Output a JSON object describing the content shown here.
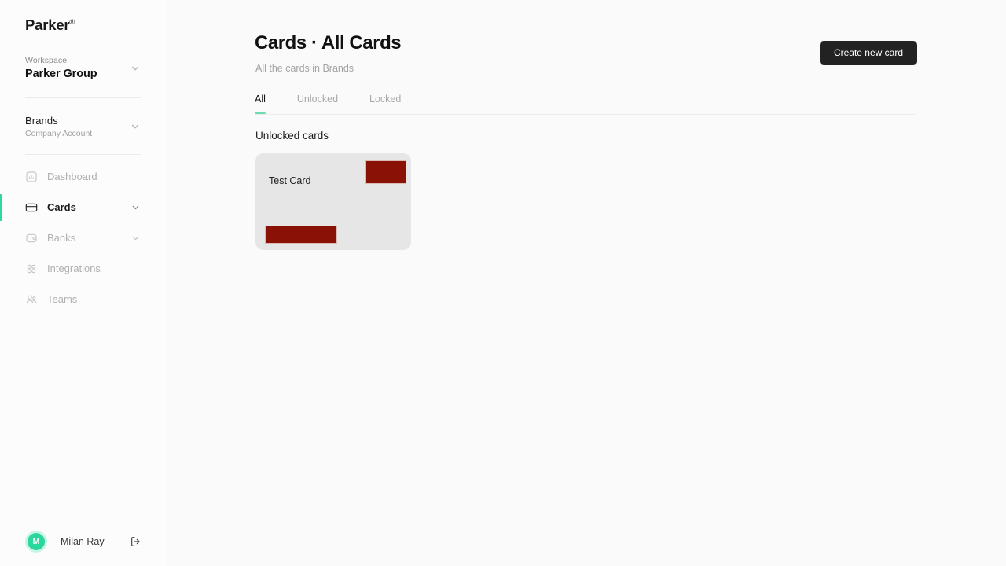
{
  "brand": {
    "name": "Parker",
    "mark": "®"
  },
  "sidebar": {
    "workspace": {
      "label": "Workspace",
      "value": "Parker Group",
      "chevron_icon": "chevron-down-icon"
    },
    "brands": {
      "label": "Brands",
      "sublabel": "Company Account",
      "chevron_icon": "chevron-down-icon"
    },
    "nav": [
      {
        "label": "Dashboard",
        "icon": "dashboard-icon",
        "active": false,
        "expandable": false
      },
      {
        "label": "Cards",
        "icon": "credit-card-icon",
        "active": true,
        "expandable": true
      },
      {
        "label": "Banks",
        "icon": "wallet-icon",
        "active": false,
        "expandable": true
      },
      {
        "label": "Integrations",
        "icon": "grid-icon",
        "active": false,
        "expandable": false
      },
      {
        "label": "Teams",
        "icon": "users-icon",
        "active": false,
        "expandable": false
      }
    ],
    "user": {
      "name": "Milan Ray",
      "initial": "M",
      "logout_icon": "logout-icon"
    }
  },
  "header": {
    "title": "Cards · All Cards",
    "subtitle": "All the cards in Brands",
    "create_button": "Create new card"
  },
  "tabs": [
    {
      "label": "All",
      "active": true
    },
    {
      "label": "Unlocked",
      "active": false
    },
    {
      "label": "Locked",
      "active": false
    }
  ],
  "content": {
    "section_title": "Unlocked cards",
    "cards": [
      {
        "name": "Test Card",
        "brand_mark": "redacted",
        "number": "redacted"
      }
    ]
  },
  "colors": {
    "accent_green": "#30d89c",
    "tab_underline": "#6ddcb0",
    "avatar": "#2ad79d",
    "button_dark": "#222222",
    "redaction_red": "#8a1106",
    "card_tile": "#e6e6e6",
    "page_background": "#fafafa"
  }
}
